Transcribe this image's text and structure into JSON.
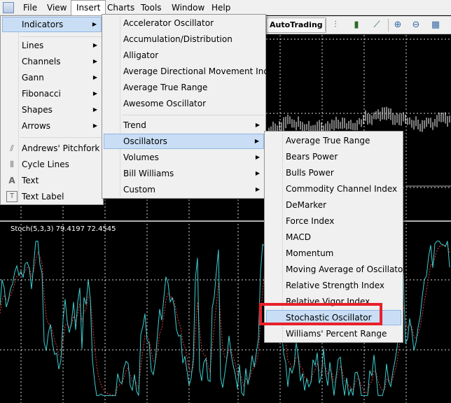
{
  "menubar": {
    "items": [
      {
        "label": "File"
      },
      {
        "label": "View"
      },
      {
        "label": "Insert"
      },
      {
        "label": "Charts"
      },
      {
        "label": "Tools"
      },
      {
        "label": "Window"
      },
      {
        "label": "Help"
      }
    ]
  },
  "toolbar": {
    "autotrading_label": "AutoTrading"
  },
  "chart": {
    "indicator_label": "Stoch(5,3,3) 79.4197 72.4545",
    "main_color": "#3ecfd1",
    "signal_color": "#e23b3b"
  },
  "insert_menu": {
    "items": [
      {
        "label": "Indicators"
      },
      {
        "label": "Lines"
      },
      {
        "label": "Channels"
      },
      {
        "label": "Gann"
      },
      {
        "label": "Fibonacci"
      },
      {
        "label": "Shapes"
      },
      {
        "label": "Arrows"
      },
      {
        "label": "Andrews' Pitchfork"
      },
      {
        "label": "Cycle Lines"
      },
      {
        "label": "Text"
      },
      {
        "label": "Text Label"
      }
    ]
  },
  "indicators_menu": {
    "items": [
      {
        "label": "Accelerator Oscillator"
      },
      {
        "label": "Accumulation/Distribution"
      },
      {
        "label": "Alligator"
      },
      {
        "label": "Average Directional Movement Index"
      },
      {
        "label": "Average True Range"
      },
      {
        "label": "Awesome Oscillator"
      },
      {
        "label": "Trend"
      },
      {
        "label": "Oscillators"
      },
      {
        "label": "Volumes"
      },
      {
        "label": "Bill Williams"
      },
      {
        "label": "Custom"
      }
    ]
  },
  "oscillators_menu": {
    "items": [
      {
        "label": "Average True Range"
      },
      {
        "label": "Bears Power"
      },
      {
        "label": "Bulls Power"
      },
      {
        "label": "Commodity Channel Index"
      },
      {
        "label": "DeMarker"
      },
      {
        "label": "Force Index"
      },
      {
        "label": "MACD"
      },
      {
        "label": "Momentum"
      },
      {
        "label": "Moving Average of Oscillator"
      },
      {
        "label": "Relative Strength Index"
      },
      {
        "label": "Relative Vigor Index"
      },
      {
        "label": "Stochastic Oscillator"
      },
      {
        "label": "Williams' Percent Range"
      }
    ]
  },
  "accent": {
    "highlight_border": "#e8202a",
    "selection_bg": "#c9def5"
  }
}
